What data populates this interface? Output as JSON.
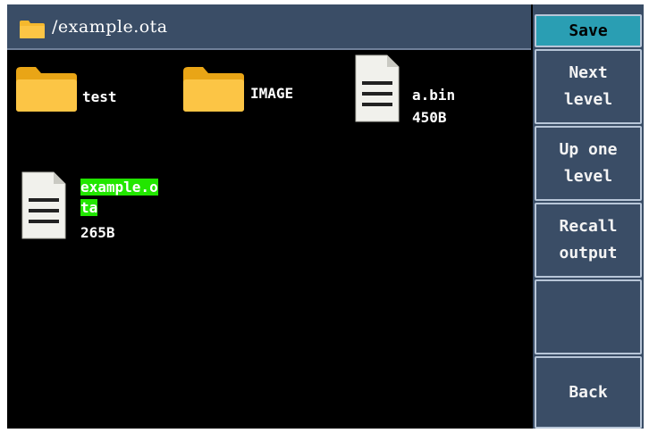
{
  "header": {
    "folder_icon": "folder-icon",
    "path": "/example.ota"
  },
  "files": [
    {
      "type": "folder",
      "icon": "folder-icon",
      "name": "test"
    },
    {
      "type": "folder",
      "icon": "folder-icon",
      "name": "IMAGE"
    },
    {
      "type": "file",
      "icon": "document-icon",
      "name": "a.bin",
      "size": "450B"
    },
    {
      "type": "file",
      "icon": "document-icon",
      "name_line1": "example.o",
      "name_line2": "ta",
      "size": "265B",
      "selected": true
    }
  ],
  "menu": {
    "save": "Save",
    "next_level": "Next\nlevel",
    "up_one_level": "Up one\nlevel",
    "recall_output": "Recall\noutput",
    "empty": "",
    "back": "Back"
  },
  "colors": {
    "panel": "#3a4d66",
    "active_button": "#2a9eb3",
    "selection": "#22e600",
    "folder": "#f5b82e"
  }
}
